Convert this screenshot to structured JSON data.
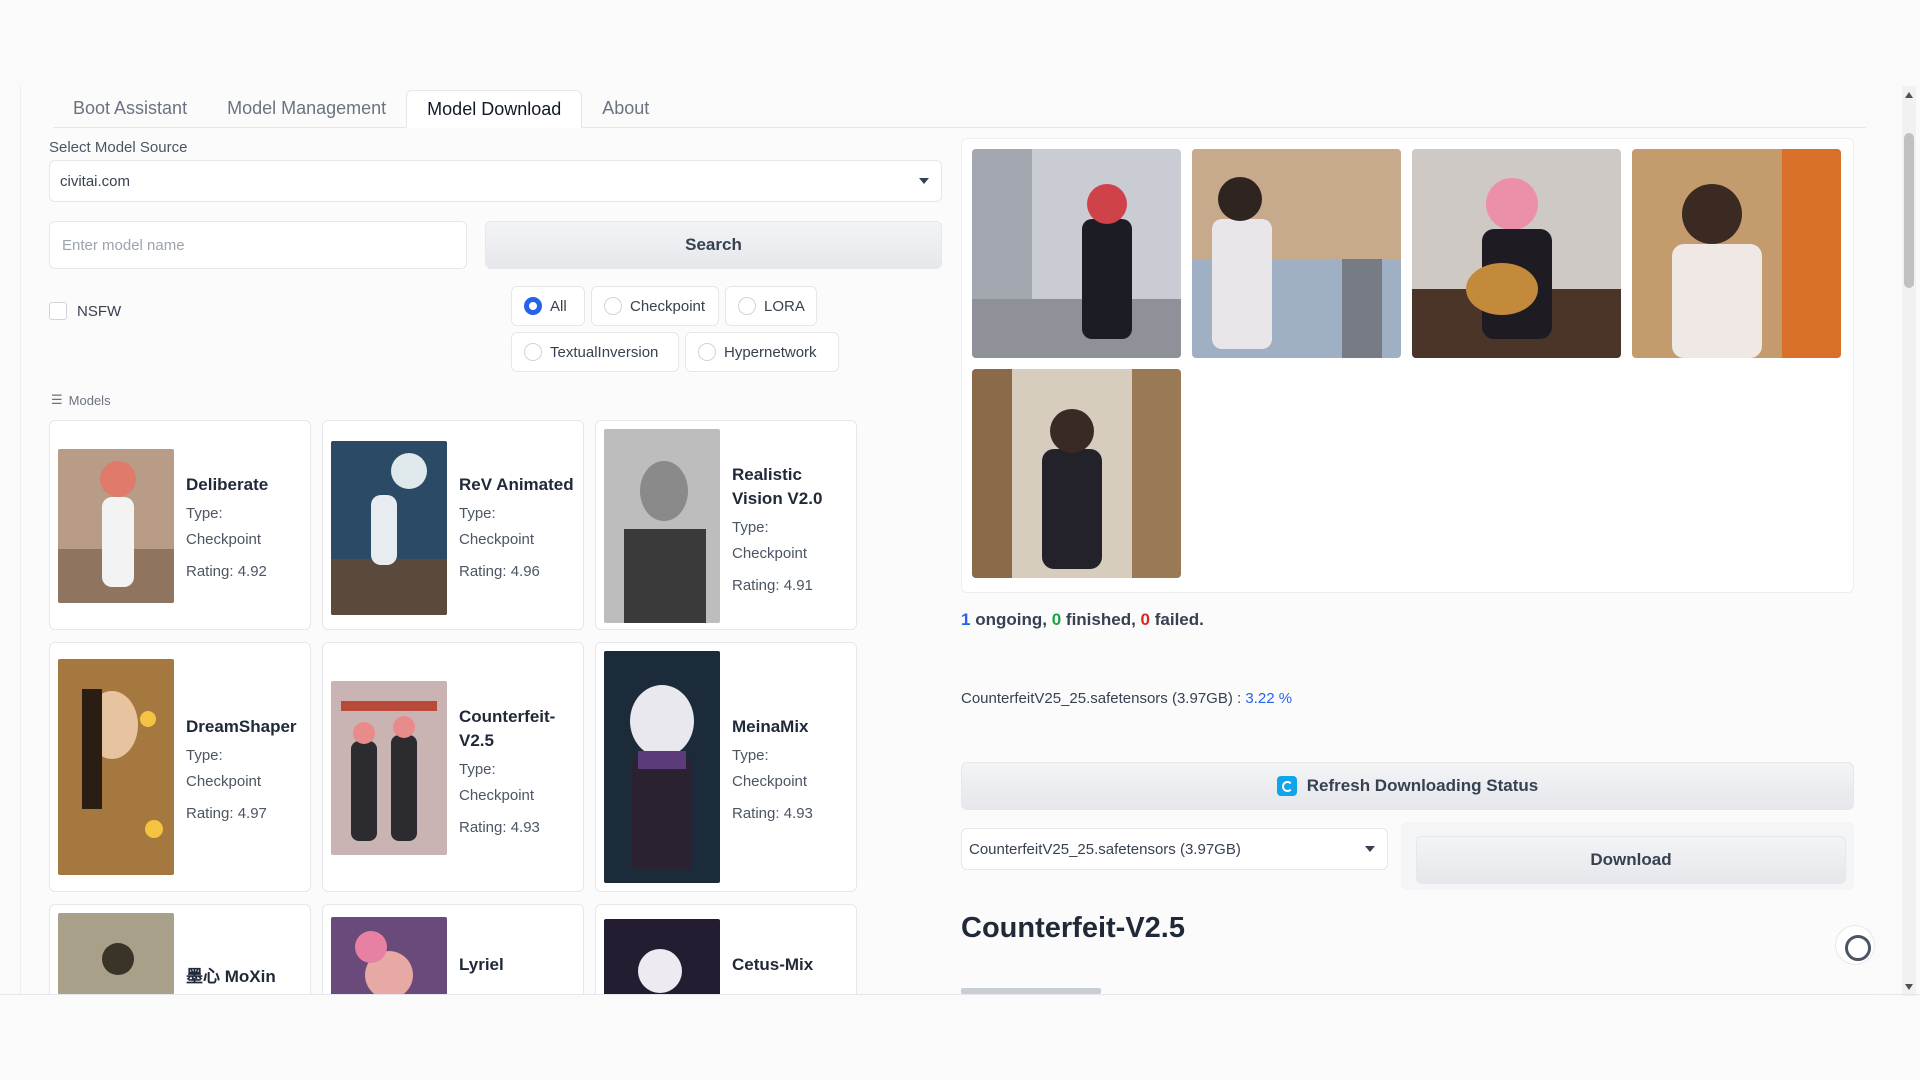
{
  "tabs": [
    {
      "label": "Boot Assistant"
    },
    {
      "label": "Model Management"
    },
    {
      "label": "Model Download"
    },
    {
      "label": "About"
    }
  ],
  "source": {
    "label": "Select Model Source",
    "value": "civitai.com"
  },
  "search": {
    "placeholder": "Enter model name",
    "button": "Search"
  },
  "nsfw_label": "NSFW",
  "filters": [
    "All",
    "Checkpoint",
    "LORA",
    "TextualInversion",
    "Hypernetwork"
  ],
  "models_label": "Models",
  "models": [
    {
      "name": "Deliberate",
      "type_label": "Type:",
      "type": "Checkpoint",
      "rating": "Rating: 4.92"
    },
    {
      "name": "ReV Animated",
      "type_label": "Type:",
      "type": "Checkpoint",
      "rating": "Rating: 4.96"
    },
    {
      "name": "Realistic Vision V2.0",
      "type_label": "Type:",
      "type": "Checkpoint",
      "rating": "Rating: 4.91"
    },
    {
      "name": "DreamShaper",
      "type_label": "Type:",
      "type": "Checkpoint",
      "rating": "Rating: 4.97"
    },
    {
      "name": "Counterfeit-V2.5",
      "type_label": "Type:",
      "type": "Checkpoint",
      "rating": "Rating: 4.93"
    },
    {
      "name": "MeinaMix",
      "type_label": "Type:",
      "type": "Checkpoint",
      "rating": "Rating: 4.93"
    },
    {
      "name": "墨心 MoXin"
    },
    {
      "name": "Lyriel"
    },
    {
      "name": "Cetus-Mix"
    }
  ],
  "status": {
    "ongoing": "1",
    "ongoing_text": "ongoing,",
    "finished": "0",
    "finished_text": "finished,",
    "failed": "0",
    "failed_text": "failed."
  },
  "progress": {
    "file": "CounterfeitV25_25.safetensors (3.97GB) :",
    "percent": "3.22 %"
  },
  "refresh_button": "Refresh Downloading Status",
  "download_select": "CounterfeitV25_25.safetensors (3.97GB)",
  "download_button": "Download",
  "selected_model_title": "Counterfeit-V2.5",
  "colors": {
    "accent": "#2563eb",
    "finished": "#16a34a",
    "failed": "#dc2626"
  }
}
